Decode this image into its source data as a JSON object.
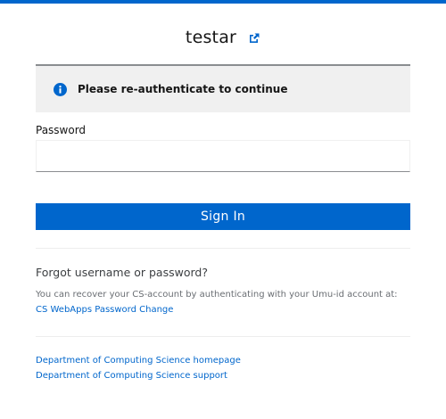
{
  "header": {
    "username": "testar",
    "restart_icon": "external-link-icon"
  },
  "alert": {
    "icon": "info-circle-icon",
    "message": "Please re-authenticate to continue"
  },
  "form": {
    "password_label": "Password",
    "password_value": "",
    "signin_label": "Sign In"
  },
  "help": {
    "forgot_title": "Forgot username or password?",
    "recover_text": "You can recover your CS-account by authenticating with your Umu-id account at:",
    "recover_link": "CS WebApps Password Change"
  },
  "footer": {
    "links": [
      "Department of Computing Science homepage",
      "Department of Computing Science support"
    ]
  },
  "colors": {
    "accent": "#0066cc",
    "alert_bg": "#f0f0f0"
  }
}
